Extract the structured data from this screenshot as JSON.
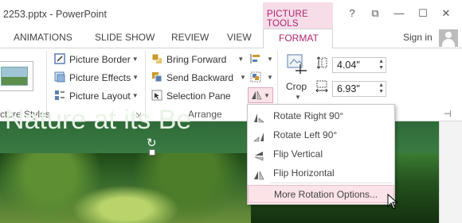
{
  "window": {
    "title": "2253.pptx - PowerPoint",
    "context_group": "PICTURE TOOLS",
    "help": "?",
    "restore_ribbon": "⧉",
    "minimize": "—",
    "maximize": "☐",
    "close": "✕"
  },
  "tabs": {
    "animations": "ANIMATIONS",
    "slide_show": "SLIDE SHOW",
    "review": "REVIEW",
    "view": "VIEW",
    "format": "FORMAT",
    "sign_in": "Sign in"
  },
  "ribbon": {
    "picture_border": "Picture Border",
    "picture_effects": "Picture Effects",
    "picture_layout": "Picture Layout",
    "bring_forward": "Bring Forward",
    "send_backward": "Send Backward",
    "selection_pane": "Selection Pane",
    "crop": "Crop",
    "height": "4.04\"",
    "width": "6.93\"",
    "group_picture_styles": "cture Styles",
    "group_arrange": "Arrange"
  },
  "slide": {
    "title": "Nature at its Be"
  },
  "menu": {
    "items": [
      {
        "label": "Rotate Right 90°"
      },
      {
        "label": "Rotate Left 90°"
      },
      {
        "label": "Flip Vertical"
      },
      {
        "label": "Flip Horizontal"
      },
      {
        "label": "More Rotation Options..."
      }
    ]
  },
  "colors": {
    "accent": "#b0256d",
    "context_tab_bg": "#f6dde8",
    "menu_highlight": "#fbe3e8"
  }
}
